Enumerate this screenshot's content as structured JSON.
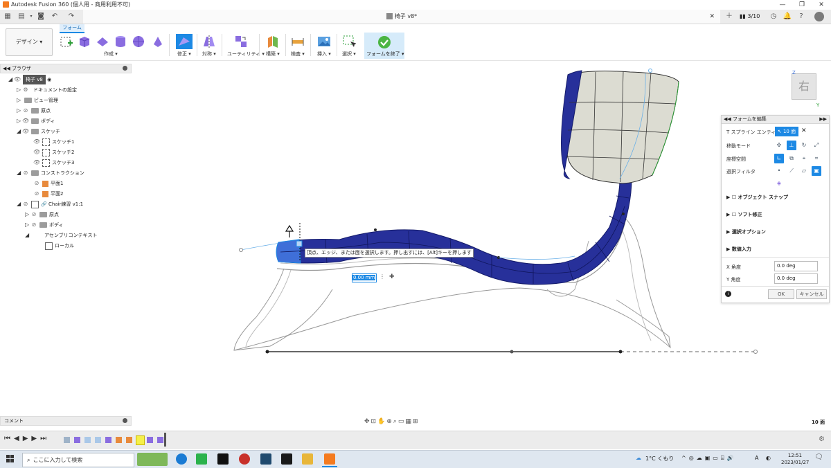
{
  "window": {
    "title": "Autodesk Fusion 360 (個人用 - 商用利用不可)",
    "doc_title": "椅子 v8*",
    "version_count": "3/10"
  },
  "toolbar": {
    "workspace": "デザイン",
    "active_tab": "フォーム",
    "groups": [
      "作成",
      "修正",
      "対称",
      "ユーティリティ",
      "構築",
      "検査",
      "挿入",
      "選択",
      "フォームを終了"
    ]
  },
  "browser": {
    "header": "ブラウザ",
    "items": [
      {
        "label": "椅子 v8",
        "depth": 0,
        "kind": "root"
      },
      {
        "label": "ドキュメントの設定",
        "depth": 1,
        "kind": "gear"
      },
      {
        "label": "ビュー管理",
        "depth": 1,
        "kind": "folder"
      },
      {
        "label": "原点",
        "depth": 1,
        "kind": "folder"
      },
      {
        "label": "ボディ",
        "depth": 1,
        "kind": "folder"
      },
      {
        "label": "スケッチ",
        "depth": 1,
        "kind": "folder"
      },
      {
        "label": "スケッチ1",
        "depth": 2,
        "kind": "sketch"
      },
      {
        "label": "スケッチ2",
        "depth": 2,
        "kind": "sketch"
      },
      {
        "label": "スケッチ3",
        "depth": 2,
        "kind": "sketch"
      },
      {
        "label": "コンストラクション",
        "depth": 1,
        "kind": "folder"
      },
      {
        "label": "平面1",
        "depth": 2,
        "kind": "plane"
      },
      {
        "label": "平面2",
        "depth": 2,
        "kind": "plane"
      },
      {
        "label": "Chair練習 v1:1",
        "depth": 1,
        "kind": "link"
      },
      {
        "label": "原点",
        "depth": 2,
        "kind": "folder"
      },
      {
        "label": "ボディ",
        "depth": 2,
        "kind": "folder"
      },
      {
        "label": "アセンブリコンテキスト",
        "depth": 2,
        "kind": "plain"
      },
      {
        "label": "ローカル",
        "depth": 3,
        "kind": "plain"
      }
    ]
  },
  "viewport": {
    "tooltip": "頂点、エッジ、または面を選択します。押し出すには、[Alt]キーを押します",
    "distance_value": "0.00 mm",
    "viewcube_label": "右",
    "axis_z": "Z",
    "axis_y": "Y",
    "face_count": "10 面"
  },
  "edit_panel": {
    "title": "フォームを編集",
    "tspline_label": "T スプライン エンティティ",
    "tspline_value": "10 面",
    "move_mode": "移動モード",
    "coord_space": "座標空間",
    "select_filter": "選択フィルタ",
    "object_snap": "オブジェクト スナップ",
    "soft_modify": "ソフト修正",
    "select_options": "選択オプション",
    "numeric_input": "数値入力",
    "x_angle_label": "X 角度",
    "x_angle": "0.0 deg",
    "y_angle_label": "Y 角度",
    "y_angle": "0.0 deg",
    "ok": "OK",
    "cancel": "キャンセル"
  },
  "comment": {
    "label": "コメント"
  },
  "taskbar": {
    "search_placeholder": "ここに入力して検索",
    "weather": "1°C くもり",
    "ime": "A",
    "time": "12:51",
    "date": "2023/01/27"
  },
  "colors": {
    "accent": "#1d89e4",
    "selection": "#2336b8",
    "seat_body": "#27309a",
    "back_panel": "#dcdcd2"
  }
}
